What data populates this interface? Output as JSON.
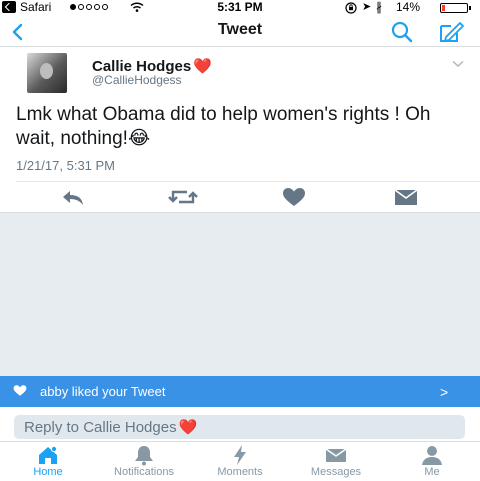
{
  "status_bar": {
    "carrier": "Safari",
    "signal_dots": [
      true,
      false,
      false,
      false,
      false
    ],
    "time": "5:31 PM",
    "battery_percent": "14%",
    "battery_level": 0.14,
    "icons": [
      "back-to-app-icon",
      "wifi-icon",
      "rotation-lock-icon",
      "location-icon",
      "bluetooth-icon",
      "battery-icon"
    ]
  },
  "nav": {
    "title": "Tweet",
    "icons": [
      "back-chevron-icon",
      "search-icon",
      "compose-icon"
    ]
  },
  "tweet": {
    "author_name": "Callie Hodges",
    "author_emoji": "❤️",
    "author_handle": "@CallieHodgess",
    "text": "Lmk what Obama did to help women's rights ! Oh wait, nothing!😂",
    "timestamp": "1/21/17, 5:31 PM",
    "actions": [
      "reply-icon",
      "retweet-icon",
      "like-icon",
      "direct-message-icon"
    ]
  },
  "notification": {
    "text": "abby liked your Tweet",
    "chevron": ">"
  },
  "reply": {
    "placeholder": "Reply to Callie Hodges",
    "emoji": "❤️"
  },
  "tabs": [
    {
      "label": "Home",
      "icon": "home-icon",
      "active": true
    },
    {
      "label": "Notifications",
      "icon": "bell-icon",
      "active": false
    },
    {
      "label": "Moments",
      "icon": "lightning-icon",
      "active": false
    },
    {
      "label": "Messages",
      "icon": "envelope-icon",
      "active": false
    },
    {
      "label": "Me",
      "icon": "person-icon",
      "active": false
    }
  ],
  "colors": {
    "accent": "#1da1f2",
    "banner": "#3a92e6",
    "secondary_text": "#657786",
    "background_gray": "#e6ecf0"
  }
}
